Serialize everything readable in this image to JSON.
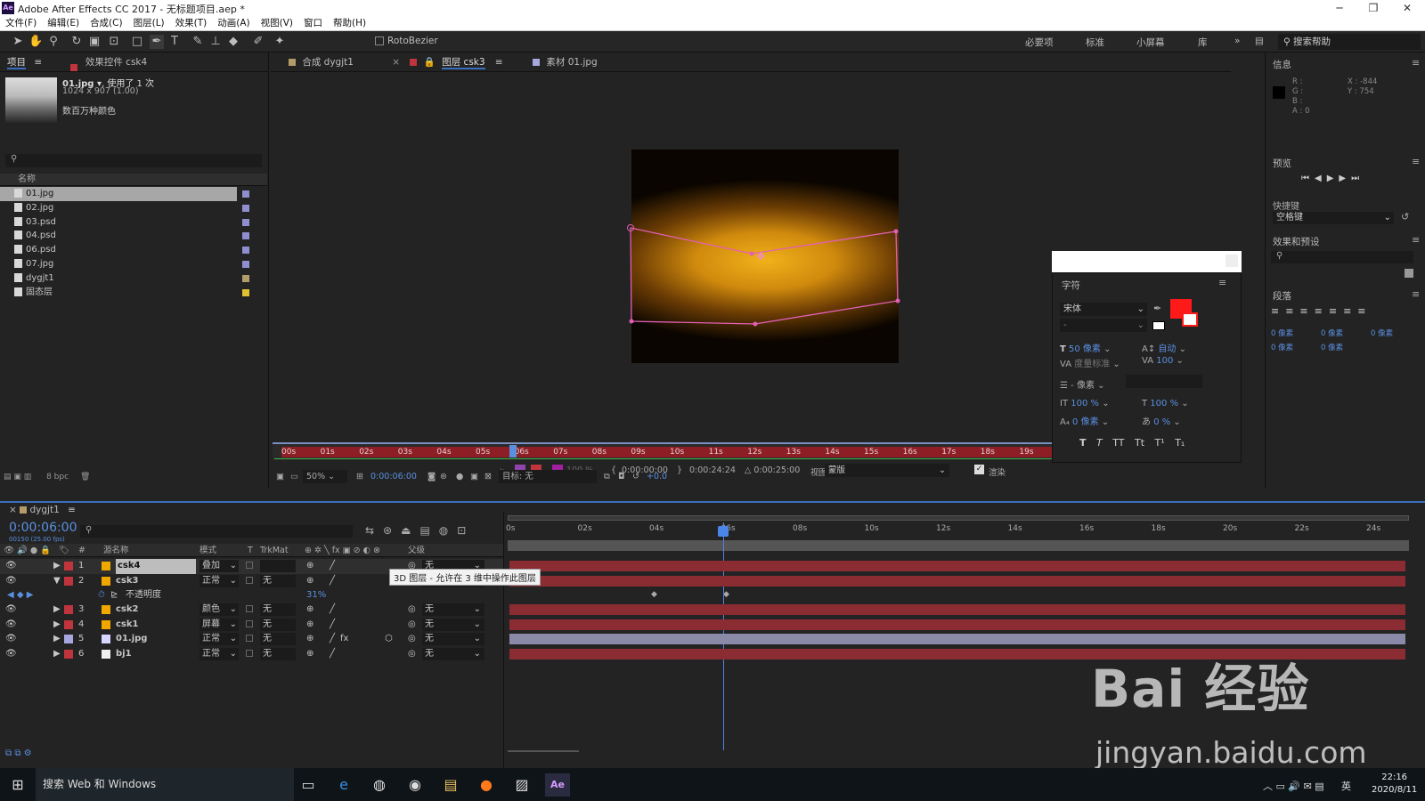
{
  "window": {
    "app_badge": "Ae",
    "title": "Adobe After Effects CC 2017 - 无标题项目.aep *"
  },
  "menu": [
    "文件(F)",
    "编辑(E)",
    "合成(C)",
    "图层(L)",
    "效果(T)",
    "动画(A)",
    "视图(V)",
    "窗口",
    "帮助(H)"
  ],
  "toolbar": {
    "rotobezier": "RotoBezier",
    "workspaces": [
      "必要项",
      "标准",
      "小屏幕",
      "库"
    ],
    "search_placeholder": "搜索帮助"
  },
  "project": {
    "tab_project": "项目",
    "tab_effects": "效果控件 csk4",
    "preview_name": "01.jpg ▾",
    "preview_used": ", 使用了 1 次",
    "preview_dims": "1024 x 907 (1.00)",
    "preview_colors": "数百万种颜色",
    "col_name": "名称",
    "items": [
      {
        "name": "01.jpg",
        "color": "#8f8fd0",
        "selected": true
      },
      {
        "name": "02.jpg",
        "color": "#8f8fd0"
      },
      {
        "name": "03.psd",
        "color": "#8f8fd0"
      },
      {
        "name": "04.psd",
        "color": "#8f8fd0"
      },
      {
        "name": "06.psd",
        "color": "#8f8fd0"
      },
      {
        "name": "07.jpg",
        "color": "#8f8fd0"
      },
      {
        "name": "dygjt1",
        "color": "#b49b6a"
      },
      {
        "name": "固态层",
        "color": "#e0c030"
      }
    ],
    "bpc": "8 bpc"
  },
  "viewer": {
    "tab_comp": "合成 dygjt1",
    "tab_layer": "图层 csk3",
    "tab_footage": "素材 01.jpg",
    "ruler_labels": [
      "00s",
      "01s",
      "02s",
      "03s",
      "04s",
      "05s",
      "06s",
      "07s",
      "08s",
      "09s",
      "10s",
      "11s",
      "12s",
      "13s",
      "14s",
      "15s",
      "16s",
      "17s",
      "18s",
      "19s"
    ],
    "ruler_end": "2s",
    "lower_bar": {
      "opacity": "100 %",
      "in": "0:00:00:00",
      "out": "0:00:24:24",
      "duration": "△ 0:00:25:00",
      "view_label": "视图:",
      "view_value": "蒙版",
      "render_label": "渲染"
    },
    "controls": {
      "zoom": "50%",
      "time": "0:00:06:00",
      "target": "目标: 无",
      "exposure": "+0.0"
    }
  },
  "character": {
    "title": "字符",
    "font": "宋体",
    "style": "-",
    "size": "50 像素",
    "leading": "自动",
    "kerning": "度量标准",
    "tracking": "100",
    "stroke": "- 像素",
    "vscale": "100 %",
    "hscale": "100 %",
    "baseline": "0 像素",
    "tsume": "0 %",
    "styles": [
      "T",
      "T",
      "TT",
      "Tt",
      "T¹",
      "T₁"
    ],
    "fill_color": "#ff1a1a"
  },
  "info": {
    "title": "信息",
    "r": "R :",
    "g": "G :",
    "b": "B :",
    "a": "A : 0",
    "x": "X : -844",
    "y": "Y : 754"
  },
  "preview": {
    "title": "预览",
    "shortcut_label": "快捷键",
    "shortcut_value": "空格键"
  },
  "effects": {
    "title": "效果和预设"
  },
  "paragraph": {
    "title": "段落",
    "vals": [
      "0 像素",
      "0 像素",
      "0 像素",
      "0 像素",
      "0 像素"
    ]
  },
  "timeline": {
    "comp_tab": "dygjt1",
    "timecode": "0:00:06:00",
    "fps": "00150 (25.00 fps)",
    "headers": {
      "name": "源名称",
      "mode": "模式",
      "t": "T",
      "trkmat": "TrkMat",
      "parent": "父级"
    },
    "ruler": [
      "0s",
      "02s",
      "04s",
      "06s",
      "08s",
      "10s",
      "12s",
      "14s",
      "16s",
      "18s",
      "20s",
      "22s",
      "24s"
    ],
    "tooltip": "3D 图层 - 允许在 3 维中操作此图层",
    "layers": [
      {
        "num": "1",
        "name": "csk4",
        "mode": "叠加",
        "trk": "",
        "parent": "无",
        "color": "#f0a800",
        "label": "#c0343d"
      },
      {
        "num": "2",
        "name": "csk3",
        "mode": "正常",
        "trk": "无",
        "parent": "无",
        "color": "#f0a800",
        "label": "#c0343d"
      },
      {
        "num": "3",
        "name": "csk2",
        "mode": "颜色",
        "trk": "无",
        "parent": "无",
        "color": "#f0a800",
        "label": "#c0343d"
      },
      {
        "num": "4",
        "name": "csk1",
        "mode": "屏幕",
        "trk": "无",
        "parent": "无",
        "color": "#f0a800",
        "label": "#c0343d"
      },
      {
        "num": "5",
        "name": "01.jpg",
        "mode": "正常",
        "trk": "无",
        "parent": "无",
        "color": "#d6d6ff",
        "label": "#a7a7e0"
      },
      {
        "num": "6",
        "name": "bj1",
        "mode": "正常",
        "trk": "无",
        "parent": "无",
        "color": "#f0f0f0",
        "label": "#c0343d"
      }
    ],
    "opacity_label": "不透明度",
    "opacity_value": "31%"
  },
  "taskbar": {
    "search": "搜索 Web 和 Windows",
    "time": "22:16",
    "date": "2020/8/11",
    "lang": "英"
  },
  "watermark": {
    "brand": "Bai 经验",
    "url": "jingyan.baidu.com"
  }
}
